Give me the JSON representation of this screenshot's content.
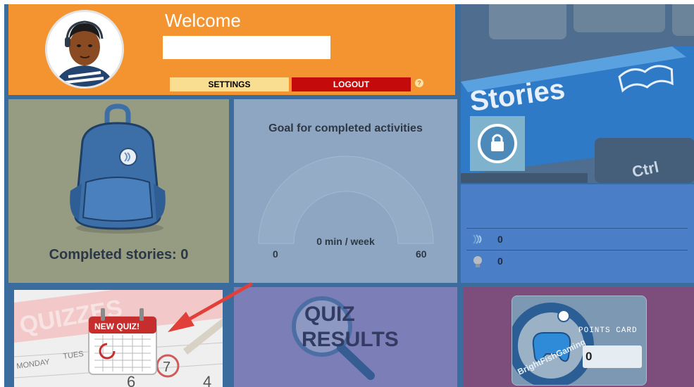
{
  "welcome": {
    "title": "Welcome",
    "name_value": "",
    "settings_label": "SETTINGS",
    "logout_label": "LOGOUT",
    "help_glyph": "?"
  },
  "stories": {
    "banner_text": "Stories",
    "key_label": "Ctrl",
    "lock_icon": "lock-icon"
  },
  "stats": {
    "rows": [
      {
        "icon": "story-waves-icon",
        "value": "0"
      },
      {
        "icon": "medal-icon",
        "value": "0"
      }
    ]
  },
  "backpack": {
    "completed_label": "Completed stories: 0"
  },
  "goal": {
    "title": "Goal for completed activities",
    "unit_label": "0 min / week",
    "min": "0",
    "max": "60",
    "level": 0
  },
  "quizzes": {
    "background_text": "QUIZZES",
    "badge_text": "NEW QUIZ!",
    "days": [
      "MONDAY",
      "TUES"
    ],
    "numbers": [
      "7",
      "6",
      "4"
    ]
  },
  "quiz_results": {
    "line1": "QUIZ",
    "line2": "RESULTS"
  },
  "points": {
    "card_title": "POINTS CARD",
    "value": "0",
    "brand": "BrightFishGaming"
  },
  "colors": {
    "orange": "#f39430",
    "logout_red": "#c40a0a",
    "settings_yellow": "#f9de91",
    "frame_blue": "#3a6d9e"
  }
}
